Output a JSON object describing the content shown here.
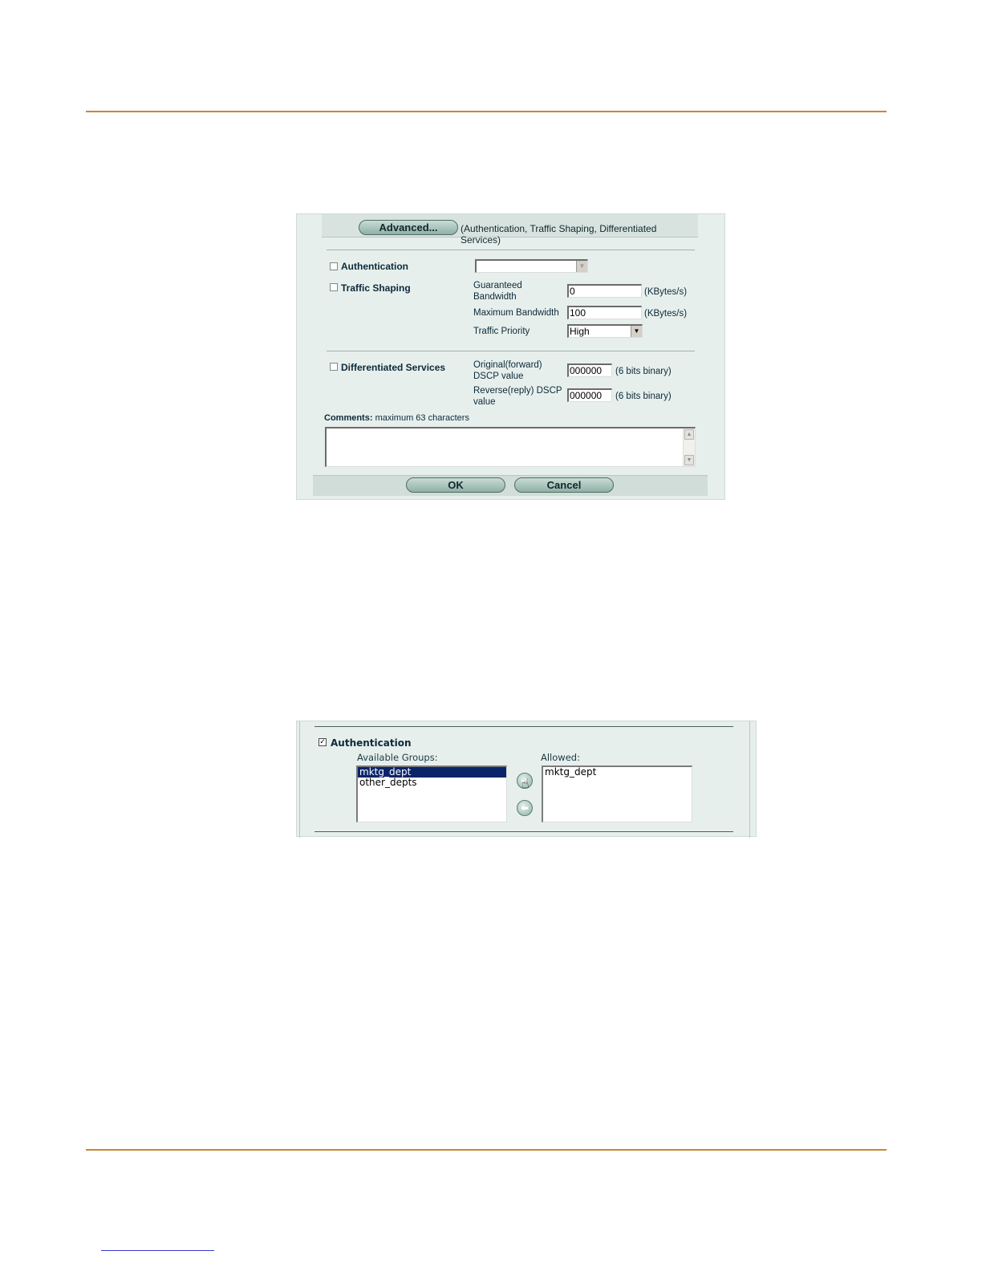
{
  "advanced": {
    "button_label": "Advanced...",
    "note": "(Authentication, Traffic Shaping, Differentiated Services)"
  },
  "authentication": {
    "label": "Authentication",
    "checked": false,
    "select_value": ""
  },
  "traffic_shaping": {
    "label": "Traffic Shaping",
    "checked": false,
    "guaranteed_label_1": "Guaranteed",
    "guaranteed_label_2": "Bandwidth",
    "guaranteed_value": "0",
    "guaranteed_unit": "(KBytes/s)",
    "max_label": "Maximum Bandwidth",
    "max_value": "100",
    "max_unit": "(KBytes/s)",
    "priority_label": "Traffic Priority",
    "priority_value": "High"
  },
  "diffserv": {
    "label": "Differentiated Services",
    "checked": false,
    "original_label_1": "Original(forward)",
    "original_label_2": "DSCP value",
    "original_value": "000000",
    "original_unit": "(6 bits binary)",
    "reverse_label_1": "Reverse(reply) DSCP",
    "reverse_label_2": "value",
    "reverse_value": "000000",
    "reverse_unit": "(6 bits binary)"
  },
  "comments": {
    "label_bold": "Comments:",
    "label_rest": " maximum 63 characters",
    "value": ""
  },
  "actions": {
    "ok": "OK",
    "cancel": "Cancel"
  },
  "auth_groups": {
    "label": "Authentication",
    "checked": true,
    "available_label": "Available Groups:",
    "available": [
      "mktg_dept",
      "other_depts"
    ],
    "selected_available": "mktg_dept",
    "allowed_label": "Allowed:",
    "allowed": [
      "mktg_dept"
    ]
  },
  "icons": {
    "add": "arrow-right-icon",
    "remove": "arrow-left-icon",
    "pointer": "hand-pointer-icon"
  },
  "colors": {
    "rule": "#c8873a",
    "panel": "#e7efec",
    "selection": "#0a246a"
  }
}
